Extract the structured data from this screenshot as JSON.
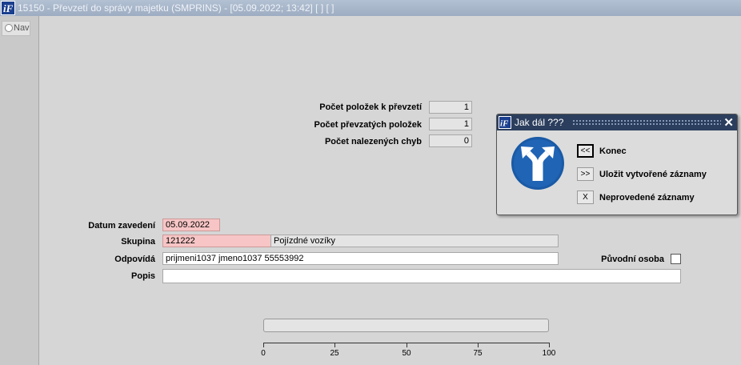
{
  "window": {
    "title": "15150 - Převzetí do správy majetku (SMPRINS) - [05.09.2022; 13:42]  [ ]  [ ]"
  },
  "nav": {
    "label": "Nav"
  },
  "counts": {
    "k_prevzeti": {
      "label": "Počet položek k převzetí",
      "value": "1"
    },
    "prevzatych": {
      "label": "Počet převzatých položek",
      "value": "1"
    },
    "chyb": {
      "label": "Počet nalezených chyb",
      "value": "0"
    }
  },
  "form": {
    "datum": {
      "label": "Datum zavedení",
      "value": "05.09.2022"
    },
    "skupina": {
      "label": "Skupina",
      "code": "121222",
      "name": "Pojízdné vozíky"
    },
    "odpovida": {
      "label": "Odpovídá",
      "value": "prijmeni1037 jmeno1037 55553992"
    },
    "puvodni": {
      "label": "Původní osoba",
      "checked": false
    },
    "popis": {
      "label": "Popis",
      "value": ""
    }
  },
  "dialog": {
    "title": "Jak dál ???",
    "icon": "fork-direction-sign-icon",
    "buttons": [
      {
        "glyph": "<<",
        "label": "Konec"
      },
      {
        "glyph": ">>",
        "label": "Uložit vytvořené záznamy"
      },
      {
        "glyph": "X",
        "label": "Neprovedené záznamy"
      }
    ]
  },
  "progress": {
    "value": 0,
    "ticks": [
      "0",
      "25",
      "50",
      "75",
      "100"
    ]
  },
  "colors": {
    "titlebar": "#a6b4c8",
    "dialog_title": "#2b3e5d",
    "required_field": "#f7c5c5"
  }
}
